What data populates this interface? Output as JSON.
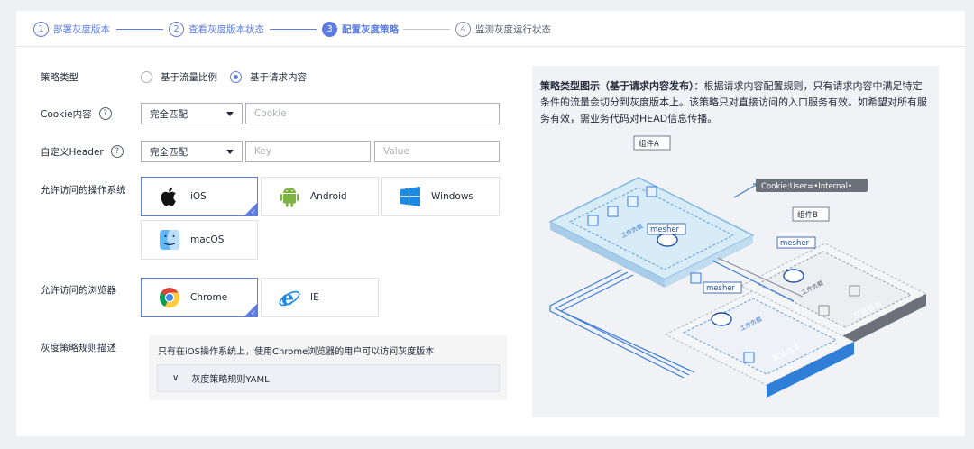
{
  "steps": [
    {
      "num": "1",
      "label": "部署灰度版本",
      "state": "done"
    },
    {
      "num": "2",
      "label": "查看灰度版本状态",
      "state": "done"
    },
    {
      "num": "3",
      "label": "配置灰度策略",
      "state": "active"
    },
    {
      "num": "4",
      "label": "监测灰度运行状态",
      "state": "todo"
    }
  ],
  "form": {
    "policy_type_label": "策略类型",
    "policy_options": [
      "基于流量比例",
      "基于请求内容"
    ],
    "policy_selected": "基于请求内容",
    "cookie_label": "Cookie内容",
    "cookie_match": "完全匹配",
    "cookie_placeholder": "Cookie",
    "header_label": "自定义Header",
    "header_match": "完全匹配",
    "header_key_placeholder": "Key",
    "header_value_placeholder": "Value",
    "os_label": "允许访问的操作系统",
    "os_options": [
      {
        "name": "iOS",
        "icon": "apple-icon",
        "selected": true
      },
      {
        "name": "Android",
        "icon": "android-icon",
        "selected": false
      },
      {
        "name": "Windows",
        "icon": "windows-icon",
        "selected": false
      },
      {
        "name": "macOS",
        "icon": "finder-icon",
        "selected": false
      }
    ],
    "browser_label": "允许访问的浏览器",
    "browser_options": [
      {
        "name": "Chrome",
        "icon": "chrome-icon",
        "selected": true
      },
      {
        "name": "IE",
        "icon": "ie-icon",
        "selected": false
      }
    ],
    "rule_desc_label": "灰度策略规则描述",
    "rule_desc_text": "只有在iOS操作系统上，使用Chrome浏览器的用户可以访问灰度版本",
    "yaml_label": "灰度策略规则YAML"
  },
  "illustration": {
    "title": "策略类型图示（基于请求内容发布）",
    "colon": "：",
    "body": "根据请求内容配置规则，只有请求内容中满足特定条件的流量会切分到灰度版本上。该策略只对直接访问的入口服务有效。如希望对所有服务有效，需业务代码对HEAD信息传播。",
    "component_a": "组件A",
    "component_b": "组件B",
    "cookie_tag": "Cookie:User=•Internal•",
    "mesher": "mesher",
    "workload": "工作负载",
    "default_version": "默认版本",
    "gray_version": "灰度版本"
  },
  "colors": {
    "accent": "#5e7ce0",
    "diagram_blue": "#3a7bd5",
    "gray_block": "#6b717a"
  }
}
